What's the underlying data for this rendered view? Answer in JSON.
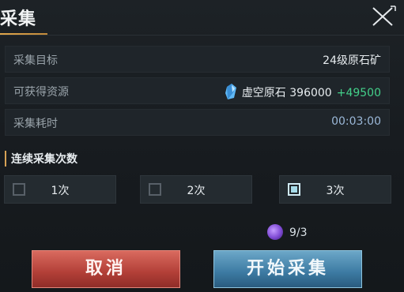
{
  "title": "采集",
  "info_rows": [
    {
      "label": "采集目标",
      "value": "24级原石矿"
    },
    {
      "label": "可获得资源",
      "resource_name": "虚空原石",
      "resource_amount": "396000",
      "resource_gain": "+49500",
      "icon": "crystal-icon"
    },
    {
      "label": "采集耗时",
      "value": "00:03:00"
    }
  ],
  "section_title": "连续采集次数",
  "choices": [
    {
      "label": "1次",
      "selected": false
    },
    {
      "label": "2次",
      "selected": false
    },
    {
      "label": "3次",
      "selected": true
    }
  ],
  "energy": {
    "text": "9/3",
    "icon": "purple-orb-icon"
  },
  "buttons": {
    "cancel": "取消",
    "start": "开始采集"
  },
  "colors": {
    "gain": "#43d08a",
    "time": "#9bb8d8",
    "accent": "#d7a256",
    "cancel": "#b23f37",
    "start": "#3c7aa2"
  }
}
